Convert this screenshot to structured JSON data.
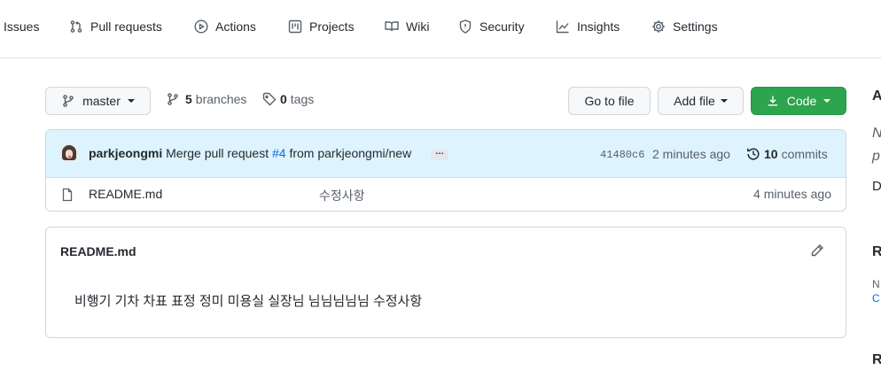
{
  "nav": {
    "items": [
      {
        "label": "Issues",
        "icon": "issue-icon"
      },
      {
        "label": "Pull requests",
        "icon": "pull-request-icon"
      },
      {
        "label": "Actions",
        "icon": "play-icon"
      },
      {
        "label": "Projects",
        "icon": "project-icon"
      },
      {
        "label": "Wiki",
        "icon": "book-icon"
      },
      {
        "label": "Security",
        "icon": "shield-icon"
      },
      {
        "label": "Insights",
        "icon": "graph-icon"
      },
      {
        "label": "Settings",
        "icon": "gear-icon"
      }
    ]
  },
  "toolbar": {
    "branch": "master",
    "branches_count": "5",
    "branches_label": "branches",
    "tags_count": "0",
    "tags_label": "tags",
    "go_to_file": "Go to file",
    "add_file": "Add file",
    "code": "Code"
  },
  "commit": {
    "author": "parkjeongmi",
    "message_prefix": "Merge pull request",
    "pr_link": "#4",
    "message_suffix": "from parkjeongmi/new",
    "ellipsis": "…",
    "sha": "41480c6",
    "time": "2 minutes ago",
    "commits_count": "10",
    "commits_label": "commits"
  },
  "files": [
    {
      "name": "README.md",
      "message": "수정사항",
      "time": "4 minutes ago"
    }
  ],
  "readme": {
    "title": "README.md",
    "body": "비행기 기차 차표 표정 정미 미용실 실장님 님님님님님 수정사항"
  },
  "sidebar_fragments": [
    "A",
    "N",
    "p",
    "D",
    "R",
    "N",
    "C",
    "R"
  ],
  "colors": {
    "accent_green": "#2da44e",
    "link_blue": "#0969da",
    "commit_bar_bg": "#ddf4ff"
  }
}
